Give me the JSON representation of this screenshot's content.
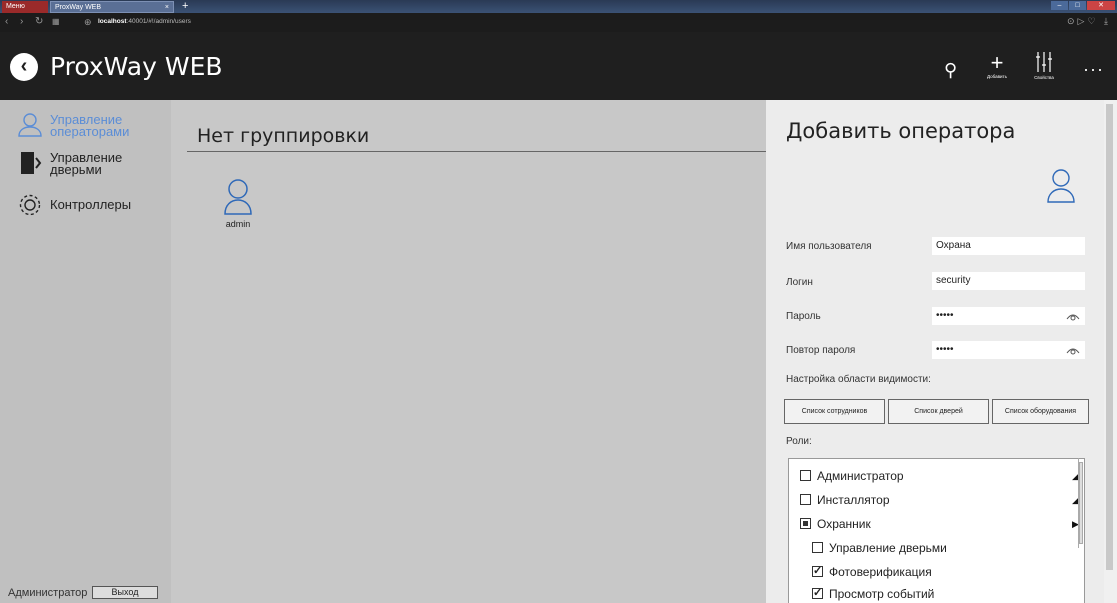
{
  "browser": {
    "menu_tab": "Меню",
    "tab_title": "ProxWay WEB",
    "tab_close": "×",
    "new_tab": "+",
    "url_host": "localhost",
    "url_rest": ":40001/#!/admin/users"
  },
  "header": {
    "app_title": "ProxWay WEB",
    "add_label": "Добавить",
    "props_label": "Свойства"
  },
  "sidebar": {
    "items": [
      {
        "label": "Управление операторами",
        "active": true
      },
      {
        "label": "Управление дверьми"
      },
      {
        "label": "Контроллеры"
      }
    ],
    "footer_user": "Администратор",
    "logout": "Выход"
  },
  "main": {
    "group_title": "Нет группировки",
    "users": [
      {
        "name": "admin"
      }
    ]
  },
  "panel": {
    "title": "Добавить оператора",
    "fields": {
      "username_label": "Имя пользователя",
      "username_value": "Охрана",
      "login_label": "Логин",
      "login_value": "security",
      "password_label": "Пароль",
      "password_value": "•••••",
      "password2_label": "Повтор пароля",
      "password2_value": "•••••"
    },
    "scope_label": "Настройка области видимости:",
    "scope_buttons": [
      "Список сотрудников",
      "Список дверей",
      "Список оборудования"
    ],
    "roles_label": "Роли:",
    "roles": [
      {
        "label": "Администратор",
        "state": "unchecked",
        "expand": "◢"
      },
      {
        "label": "Инсталлятор",
        "state": "unchecked",
        "expand": "◢"
      },
      {
        "label": "Охранник",
        "state": "partial",
        "expand": "▶"
      },
      {
        "label": "Управление дверьми",
        "state": "unchecked"
      },
      {
        "label": "Фотоверификация",
        "state": "checked"
      },
      {
        "label": "Просмотр событий",
        "state": "checked"
      }
    ]
  },
  "colors": {
    "accent": "#5b8dd6",
    "header_bg": "#1f1f1f",
    "sidebar_bg": "#c0c0c0",
    "panel_bg": "#ececec"
  }
}
